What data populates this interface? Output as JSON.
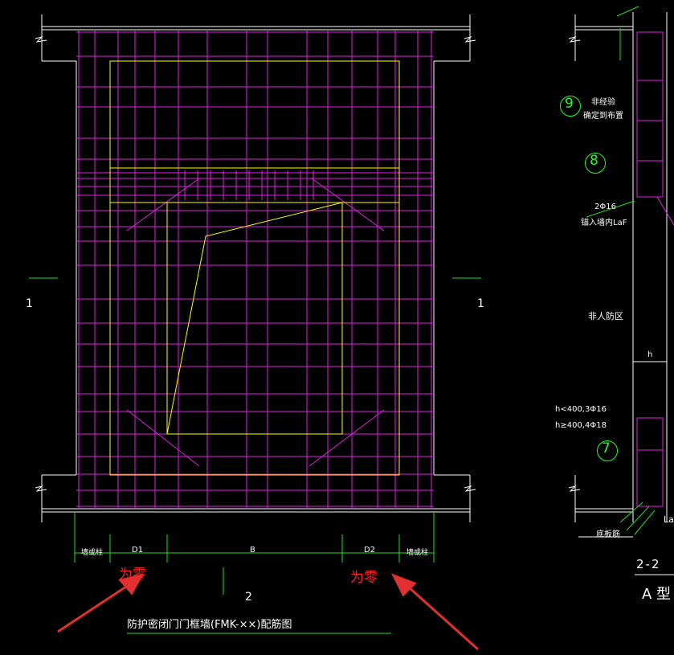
{
  "drawing": {
    "title": "防护密闭门门框墙(FMK-××)配筋图",
    "dim_labels": [
      "墙或柱",
      "D1",
      "B",
      "D2",
      "墙或柱"
    ],
    "section_marks": {
      "left": "1",
      "right": "1",
      "bottom": "2"
    },
    "annotations": {
      "left": "为零",
      "right": "为零"
    }
  },
  "detail": {
    "section_title": "2-2",
    "type_label": "A 型",
    "circles": [
      "9",
      "8",
      "7"
    ],
    "notes": {
      "n9_line1": "非经验",
      "n9_line2": "确定到布置",
      "n8_bar": "2Φ16",
      "n8_anchor": "锚入墙内LaF",
      "zone": "非人防区",
      "dim_h": "h",
      "h_lt": "h<400,3Φ16",
      "h_ge": "h≥400,4Φ18",
      "bottom_bar": "底板筋",
      "la": "La"
    }
  },
  "colors": {
    "background": "#000000",
    "frame": "#ffffff",
    "rebar": "#e020e0",
    "opening": "#ffff00",
    "dimension": "#20e020",
    "annotation": "#ff2020",
    "circle": "#20ff20"
  }
}
